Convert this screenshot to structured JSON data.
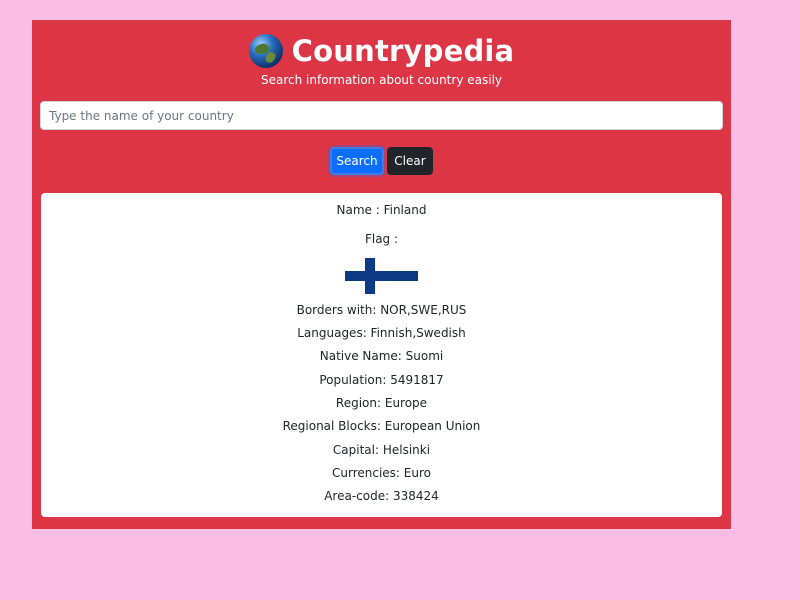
{
  "header": {
    "title": "Countrypedia",
    "subtitle": "Search information about country easily",
    "logo_icon": "globe-icon"
  },
  "search": {
    "placeholder": "Type the name of your country",
    "value": "",
    "search_label": "Search",
    "clear_label": "Clear"
  },
  "colors": {
    "background": "#fbbde6",
    "panel": "#dc3545",
    "search_button": "#0d6efd",
    "clear_button": "#212529",
    "flag_cross": "#0d3a85"
  },
  "result": {
    "name": "Name : Finland",
    "flag_label": "Flag :",
    "flag_icon": "finland-flag",
    "borders": "Borders with: NOR,SWE,RUS",
    "languages": "Languages: Finnish,Swedish",
    "native_name": "Native Name: Suomi",
    "population": "Population: 5491817",
    "region": "Region: Europe",
    "regional_blocks": "Regional Blocks: European Union",
    "capital": "Capital: Helsinki",
    "currencies": "Currencies: Euro",
    "area_code": "Area-code: 338424"
  }
}
